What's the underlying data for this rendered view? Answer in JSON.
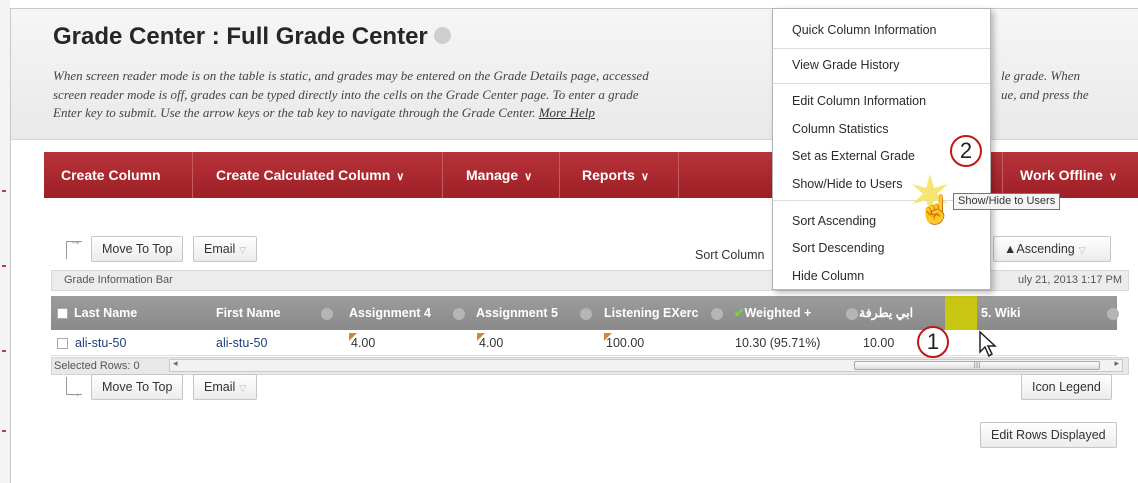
{
  "page": {
    "title": "Grade Center : Full Grade Center",
    "instructions_lines": [
      "When screen reader mode is on the table is static, and grades may be entered on the Grade Details page, accessed ",
      "screen reader mode is off, grades can be typed directly into the cells on the Grade Center page. To enter a grade",
      "Enter key to submit. Use the arrow keys or the tab key to navigate through the Grade Center."
    ],
    "instructions_tail_1": "le grade. When",
    "instructions_tail_2": "ue, and press the",
    "more_help": "More Help"
  },
  "toolbar": {
    "create_column": "Create Column",
    "create_calculated_column": "Create Calculated Column",
    "manage": "Manage",
    "reports": "Reports",
    "work_offline": "Work Offline",
    "chevron": "∨"
  },
  "actions": {
    "move_to_top": "Move To Top",
    "email": "Email",
    "sort_columns_by": "Sort Column",
    "ascending": "▲Ascending",
    "icon_legend": "Icon Legend",
    "edit_rows_displayed": "Edit Rows Displayed"
  },
  "info_bar": {
    "label": "Grade Information Bar",
    "last_saved": "uly 21, 2013 1:17 PM"
  },
  "columns": [
    "Last Name",
    "First Name",
    "Assignment 4",
    "Assignment 5",
    "Listening EXerc",
    "Weighted +",
    "ابي يطرفة",
    "5. Wiki"
  ],
  "rows": [
    {
      "last_name": "ali-stu-50",
      "first_name": "ali-stu-50",
      "assignment_4": "4.00",
      "assignment_5": "4.00",
      "listening": "100.00",
      "weighted": "10.30 (95.71%)",
      "arabic_col": "10.00"
    }
  ],
  "selected_rows": "Selected Rows: 0",
  "scroll_label": "III",
  "context_menu": {
    "items": [
      "Quick Column Information",
      "View Grade History",
      "Edit Column Information",
      "Column Statistics",
      "Set as External Grade",
      "Show/Hide to Users",
      "Sort Ascending",
      "Sort Descending",
      "Hide Column"
    ]
  },
  "tooltip": "Show/Hide to Users",
  "markers": {
    "step1": "1",
    "step2": "2"
  },
  "colors": {
    "toolbar": "#a3242b",
    "header_row": "#8f8f8f",
    "highlight": "#c9c614",
    "marker_ring": "#c01818"
  },
  "icons": {
    "check": "checkmark-icon",
    "hand": "hand-pointer-icon",
    "cursor": "arrow-cursor-icon"
  }
}
